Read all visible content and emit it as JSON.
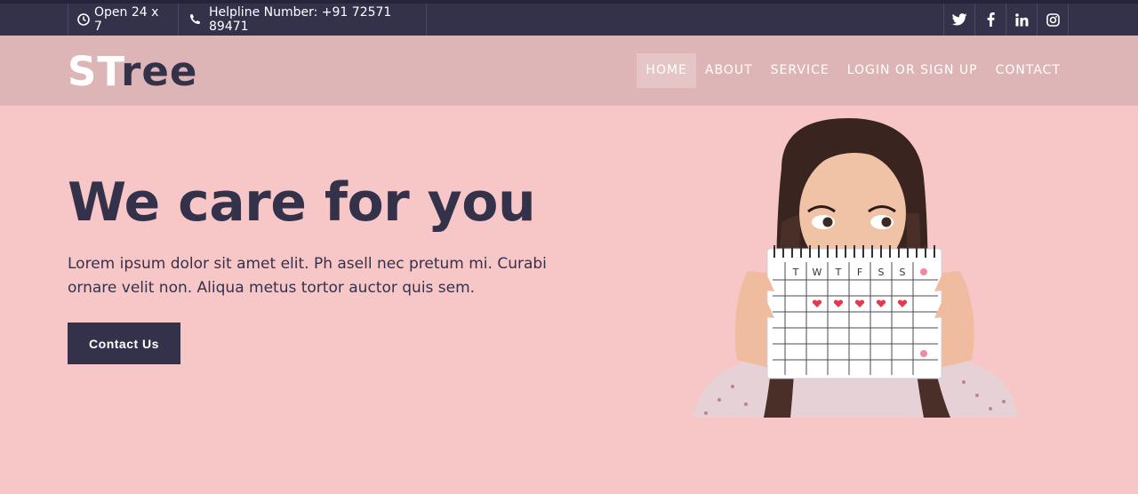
{
  "topbar": {
    "hours": "Open 24 x 7",
    "helpline": "Helpline Number: +91 72571 89471",
    "social": [
      "twitter-icon",
      "facebook-icon",
      "linkedin-icon",
      "instagram-icon"
    ]
  },
  "brand": {
    "part1": "ST",
    "part2": "ree"
  },
  "nav": {
    "items": [
      "HOME",
      "ABOUT",
      "SERVICE",
      "LOGIN OR SIGN UP",
      "CONTACT"
    ],
    "active": "HOME"
  },
  "hero": {
    "title": "We care for you",
    "description": "Lorem ipsum dolor sit amet elit. Ph asell nec pretum mi. Curabi ornare velit non. Aliqua metus tortor auctor quis sem.",
    "cta": "Contact Us",
    "calendar_days": [
      "T",
      "W",
      "T",
      "F",
      "S",
      "S"
    ]
  },
  "colors": {
    "dark": "#34314b",
    "navbar": "#deb5b6",
    "background": "#f7c7c8",
    "heart": "#e23b4f"
  }
}
